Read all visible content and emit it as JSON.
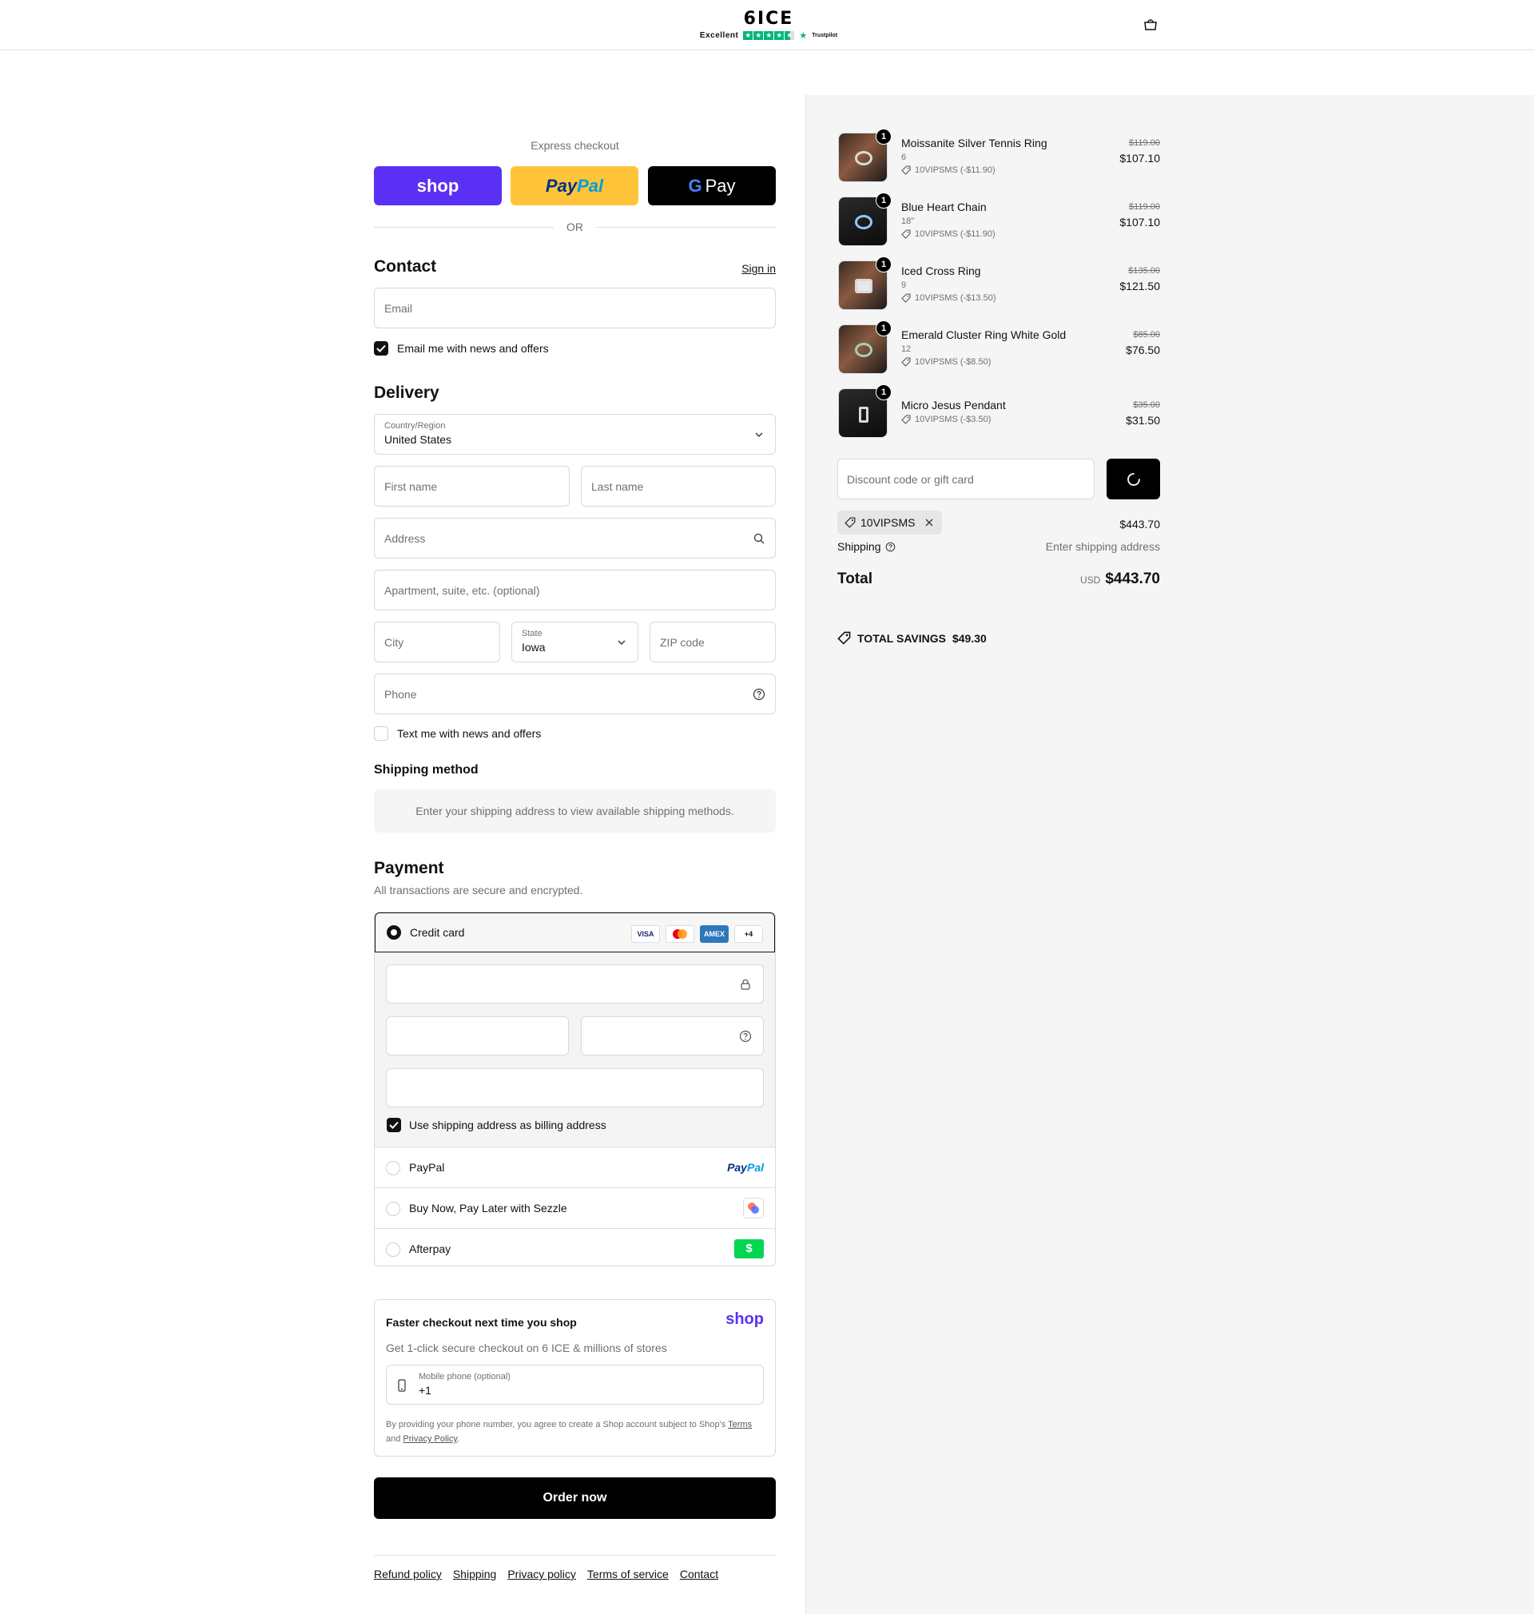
{
  "header": {
    "logo_text": "6ICE",
    "rating_text": "Excellent",
    "trustpilot": "Trustpilot",
    "cart_icon": "bag-icon"
  },
  "express": {
    "label": "Express checkout",
    "shop_label": "shop",
    "paypal_pay": "Pay",
    "paypal_pal": "Pal",
    "gpay_g": "G",
    "gpay_label": "Pay",
    "or": "OR"
  },
  "contact": {
    "title": "Contact",
    "signin": "Sign in",
    "email_placeholder": "Email",
    "email_optin": "Email me with news and offers",
    "email_optin_checked": true
  },
  "delivery": {
    "title": "Delivery",
    "country_label": "Country/Region",
    "country_value": "United States",
    "first_name": "First name",
    "last_name": "Last name",
    "address": "Address",
    "apartment": "Apartment, suite, etc. (optional)",
    "city": "City",
    "state_label": "State",
    "state_value": "Iowa",
    "zip": "ZIP code",
    "phone": "Phone",
    "text_optin": "Text me with news and offers",
    "text_optin_checked": false
  },
  "shipping_method": {
    "title": "Shipping method",
    "note": "Enter your shipping address to view available shipping methods."
  },
  "payment": {
    "title": "Payment",
    "subtitle": "All transactions are secure and encrypted.",
    "credit_card": "Credit card",
    "card_logos": [
      "VISA",
      "MC",
      "AMEX",
      "+4"
    ],
    "billing_same": "Use shipping address as billing address",
    "paypal": "PayPal",
    "paypal_logo_pay": "Pay",
    "paypal_logo_pal": "Pal",
    "sezzle": "Buy Now, Pay Later with Sezzle",
    "afterpay": "Afterpay",
    "afterpay_logo": "$"
  },
  "shop_pay": {
    "title": "Faster checkout next time you shop",
    "brand": "shop",
    "subtitle": "Get 1-click secure checkout on 6 ICE & millions of stores",
    "phone_label": "Mobile phone (optional)",
    "phone_value": "+1",
    "legal_prefix": "By providing your phone number, you agree to create a Shop account subject to Shop's",
    "terms": "Terms",
    "and": "and",
    "privacy": "Privacy Policy",
    "period": "."
  },
  "order_button": "Order now",
  "footer": {
    "links": [
      "Refund policy",
      "Shipping",
      "Privacy policy",
      "Terms of service",
      "Contact"
    ]
  },
  "summary": {
    "items": [
      {
        "name": "Moissanite Silver Tennis Ring",
        "variant": "6",
        "discount": "10VIPSMS (-$11.90)",
        "original": "$119.00",
        "price": "$107.10",
        "qty": "1"
      },
      {
        "name": "Blue Heart Chain",
        "variant": "18\"",
        "discount": "10VIPSMS (-$11.90)",
        "original": "$119.00",
        "price": "$107.10",
        "qty": "1"
      },
      {
        "name": "Iced Cross Ring",
        "variant": "9",
        "discount": "10VIPSMS (-$13.50)",
        "original": "$135.00",
        "price": "$121.50",
        "qty": "1"
      },
      {
        "name": "Emerald Cluster Ring White Gold",
        "variant": "12",
        "discount": "10VIPSMS (-$8.50)",
        "original": "$85.00",
        "price": "$76.50",
        "qty": "1"
      },
      {
        "name": "Micro Jesus Pendant",
        "variant": "",
        "discount": "10VIPSMS (-$3.50)",
        "original": "$35.00",
        "price": "$31.50",
        "qty": "1"
      }
    ],
    "discount_placeholder": "Discount code or gift card",
    "applied_code": "10VIPSMS",
    "subtotal": "$443.70",
    "shipping_label": "Shipping",
    "shipping_value": "Enter shipping address",
    "total_label": "Total",
    "currency": "USD",
    "total_value": "$443.70",
    "savings_label": "TOTAL SAVINGS",
    "savings_value": "$49.30"
  },
  "colors": {
    "shop_purple": "#5a31f4",
    "paypal_yellow": "#ffc439",
    "trustpilot_green": "#00b67a",
    "afterpay_green": "#00d64f"
  }
}
